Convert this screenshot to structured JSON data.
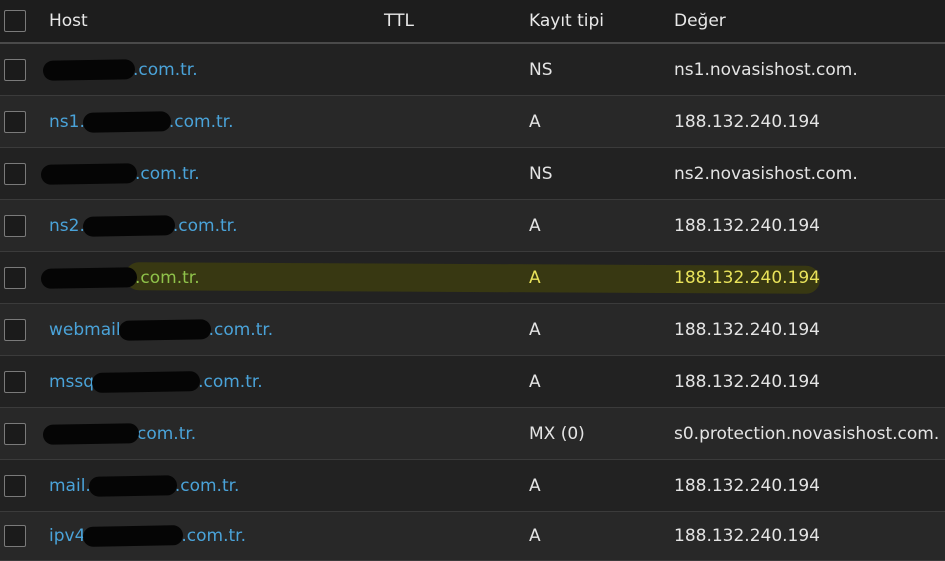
{
  "header": {
    "host": "Host",
    "ttl": "TTL",
    "type": "Kayıt tipi",
    "value": "Değer"
  },
  "records": [
    {
      "host_prefix": "",
      "host_suffix": ".com.tr.",
      "ttl": "",
      "type": "NS",
      "value": "ns1.novasishost.com.",
      "highlighted": false
    },
    {
      "host_prefix": "ns1.",
      "host_suffix": ".com.tr.",
      "ttl": "",
      "type": "A",
      "value": "188.132.240.194",
      "highlighted": false
    },
    {
      "host_prefix": "",
      "host_suffix": ".com.tr.",
      "ttl": "",
      "type": "NS",
      "value": "ns2.novasishost.com.",
      "highlighted": false
    },
    {
      "host_prefix": "ns2.",
      "host_suffix": ".com.tr.",
      "ttl": "",
      "type": "A",
      "value": "188.132.240.194",
      "highlighted": false
    },
    {
      "host_prefix": "",
      "host_suffix": ".com.tr.",
      "ttl": "",
      "type": "A",
      "value": "188.132.240.194",
      "highlighted": true
    },
    {
      "host_prefix": "webmail",
      "host_suffix": ".com.tr.",
      "ttl": "",
      "type": "A",
      "value": "188.132.240.194",
      "highlighted": false
    },
    {
      "host_prefix": "mssq",
      "host_suffix": ".com.tr.",
      "ttl": "",
      "type": "A",
      "value": "188.132.240.194",
      "highlighted": false
    },
    {
      "host_prefix": "",
      "host_suffix": "com.tr.",
      "ttl": "",
      "type": "MX (0)",
      "value": "s0.protection.novasishost.com.",
      "highlighted": false
    },
    {
      "host_prefix": "mail.",
      "host_suffix": ".com.tr.",
      "ttl": "",
      "type": "A",
      "value": "188.132.240.194",
      "highlighted": false
    },
    {
      "host_prefix": "ipv4",
      "host_suffix": ".com.tr.",
      "ttl": "",
      "type": "A",
      "value": "188.132.240.194",
      "highlighted": false
    }
  ],
  "colors": {
    "background": "#222222",
    "link": "#4aa3d9",
    "highlight": "#e8e25a"
  }
}
